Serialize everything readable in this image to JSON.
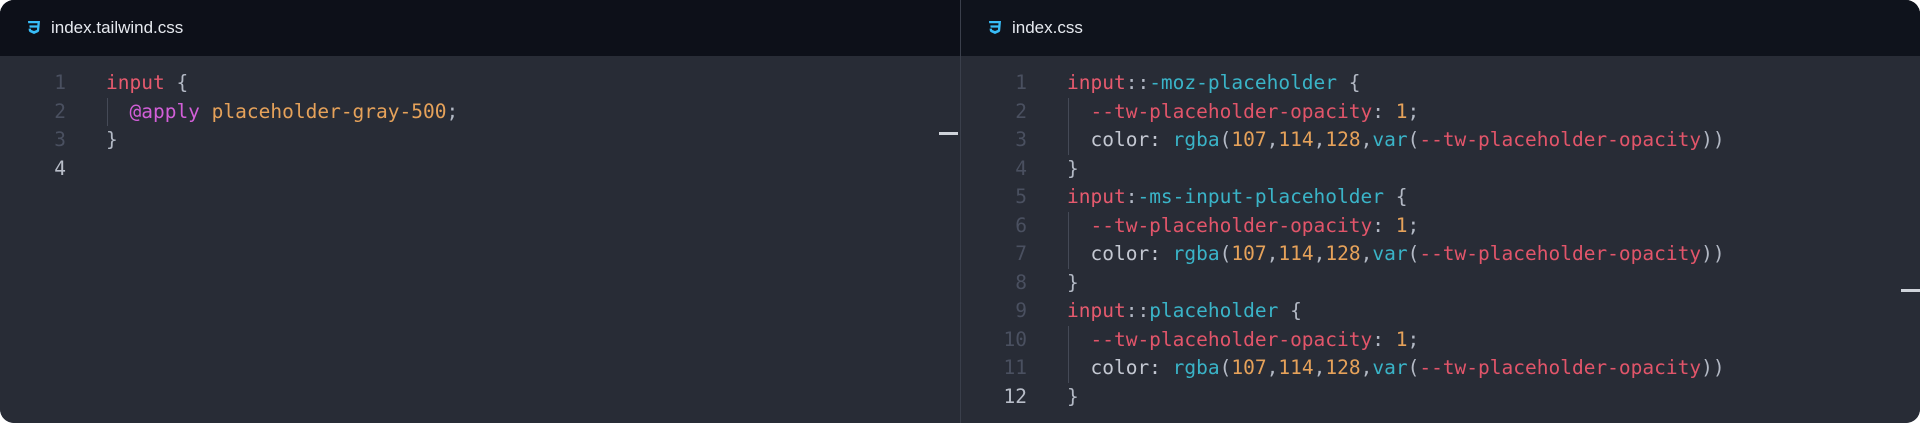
{
  "left_pane": {
    "tab_label": "index.tailwind.css",
    "tab_icon": "css3-icon",
    "lines": [
      {
        "n": "1",
        "tokens": [
          {
            "t": "input",
            "c": "selector"
          },
          {
            "t": " {",
            "c": "punct"
          }
        ]
      },
      {
        "n": "2",
        "tokens": [
          {
            "t": "  ",
            "c": "plain"
          },
          {
            "t": "@apply",
            "c": "at"
          },
          {
            "t": " placeholder-gray-500",
            "c": "val"
          },
          {
            "t": ";",
            "c": "punct"
          }
        ]
      },
      {
        "n": "3",
        "tokens": [
          {
            "t": "}",
            "c": "punct"
          }
        ]
      },
      {
        "n": "4",
        "tokens": [],
        "active": true
      }
    ]
  },
  "right_pane": {
    "tab_label": "index.css",
    "tab_icon": "css3-icon",
    "lines": [
      {
        "n": "1",
        "tokens": [
          {
            "t": "input",
            "c": "selector"
          },
          {
            "t": "::",
            "c": "punct"
          },
          {
            "t": "-moz-placeholder",
            "c": "fn"
          },
          {
            "t": " {",
            "c": "punct"
          }
        ]
      },
      {
        "n": "2",
        "tokens": [
          {
            "t": "  ",
            "c": "plain"
          },
          {
            "t": "--tw-placeholder-opacity",
            "c": "prop"
          },
          {
            "t": ": ",
            "c": "punct"
          },
          {
            "t": "1",
            "c": "num"
          },
          {
            "t": ";",
            "c": "punct"
          }
        ]
      },
      {
        "n": "3",
        "tokens": [
          {
            "t": "  color: ",
            "c": "plain"
          },
          {
            "t": "rgba",
            "c": "fn"
          },
          {
            "t": "(",
            "c": "punct"
          },
          {
            "t": "107",
            "c": "num"
          },
          {
            "t": ",",
            "c": "punct"
          },
          {
            "t": "114",
            "c": "num"
          },
          {
            "t": ",",
            "c": "punct"
          },
          {
            "t": "128",
            "c": "num"
          },
          {
            "t": ",",
            "c": "punct"
          },
          {
            "t": "var",
            "c": "fn"
          },
          {
            "t": "(",
            "c": "punct"
          },
          {
            "t": "--tw-placeholder-opacity",
            "c": "prop"
          },
          {
            "t": "))",
            "c": "punct"
          }
        ]
      },
      {
        "n": "4",
        "tokens": [
          {
            "t": "}",
            "c": "punct"
          }
        ]
      },
      {
        "n": "5",
        "tokens": [
          {
            "t": "input",
            "c": "selector"
          },
          {
            "t": ":",
            "c": "punct"
          },
          {
            "t": "-ms-input-placeholder",
            "c": "fn"
          },
          {
            "t": " {",
            "c": "punct"
          }
        ]
      },
      {
        "n": "6",
        "tokens": [
          {
            "t": "  ",
            "c": "plain"
          },
          {
            "t": "--tw-placeholder-opacity",
            "c": "prop"
          },
          {
            "t": ": ",
            "c": "punct"
          },
          {
            "t": "1",
            "c": "num"
          },
          {
            "t": ";",
            "c": "punct"
          }
        ]
      },
      {
        "n": "7",
        "tokens": [
          {
            "t": "  color: ",
            "c": "plain"
          },
          {
            "t": "rgba",
            "c": "fn"
          },
          {
            "t": "(",
            "c": "punct"
          },
          {
            "t": "107",
            "c": "num"
          },
          {
            "t": ",",
            "c": "punct"
          },
          {
            "t": "114",
            "c": "num"
          },
          {
            "t": ",",
            "c": "punct"
          },
          {
            "t": "128",
            "c": "num"
          },
          {
            "t": ",",
            "c": "punct"
          },
          {
            "t": "var",
            "c": "fn"
          },
          {
            "t": "(",
            "c": "punct"
          },
          {
            "t": "--tw-placeholder-opacity",
            "c": "prop"
          },
          {
            "t": "))",
            "c": "punct"
          }
        ]
      },
      {
        "n": "8",
        "tokens": [
          {
            "t": "}",
            "c": "punct"
          }
        ]
      },
      {
        "n": "9",
        "tokens": [
          {
            "t": "input",
            "c": "selector"
          },
          {
            "t": "::",
            "c": "punct"
          },
          {
            "t": "placeholder",
            "c": "fn"
          },
          {
            "t": " {",
            "c": "punct"
          }
        ]
      },
      {
        "n": "10",
        "tokens": [
          {
            "t": "  ",
            "c": "plain"
          },
          {
            "t": "--tw-placeholder-opacity",
            "c": "prop"
          },
          {
            "t": ": ",
            "c": "punct"
          },
          {
            "t": "1",
            "c": "num"
          },
          {
            "t": ";",
            "c": "punct"
          }
        ]
      },
      {
        "n": "11",
        "tokens": [
          {
            "t": "  color: ",
            "c": "plain"
          },
          {
            "t": "rgba",
            "c": "fn"
          },
          {
            "t": "(",
            "c": "punct"
          },
          {
            "t": "107",
            "c": "num"
          },
          {
            "t": ",",
            "c": "punct"
          },
          {
            "t": "114",
            "c": "num"
          },
          {
            "t": ",",
            "c": "punct"
          },
          {
            "t": "128",
            "c": "num"
          },
          {
            "t": ",",
            "c": "punct"
          },
          {
            "t": "var",
            "c": "fn"
          },
          {
            "t": "(",
            "c": "punct"
          },
          {
            "t": "--tw-placeholder-opacity",
            "c": "prop"
          },
          {
            "t": "))",
            "c": "punct"
          }
        ]
      },
      {
        "n": "12",
        "tokens": [
          {
            "t": "}",
            "c": "punct"
          }
        ],
        "active": true
      }
    ]
  },
  "colors": {
    "editor_bg": "#282c36",
    "tab_bg": "#0d1019",
    "css_icon": "#38bdf8"
  }
}
